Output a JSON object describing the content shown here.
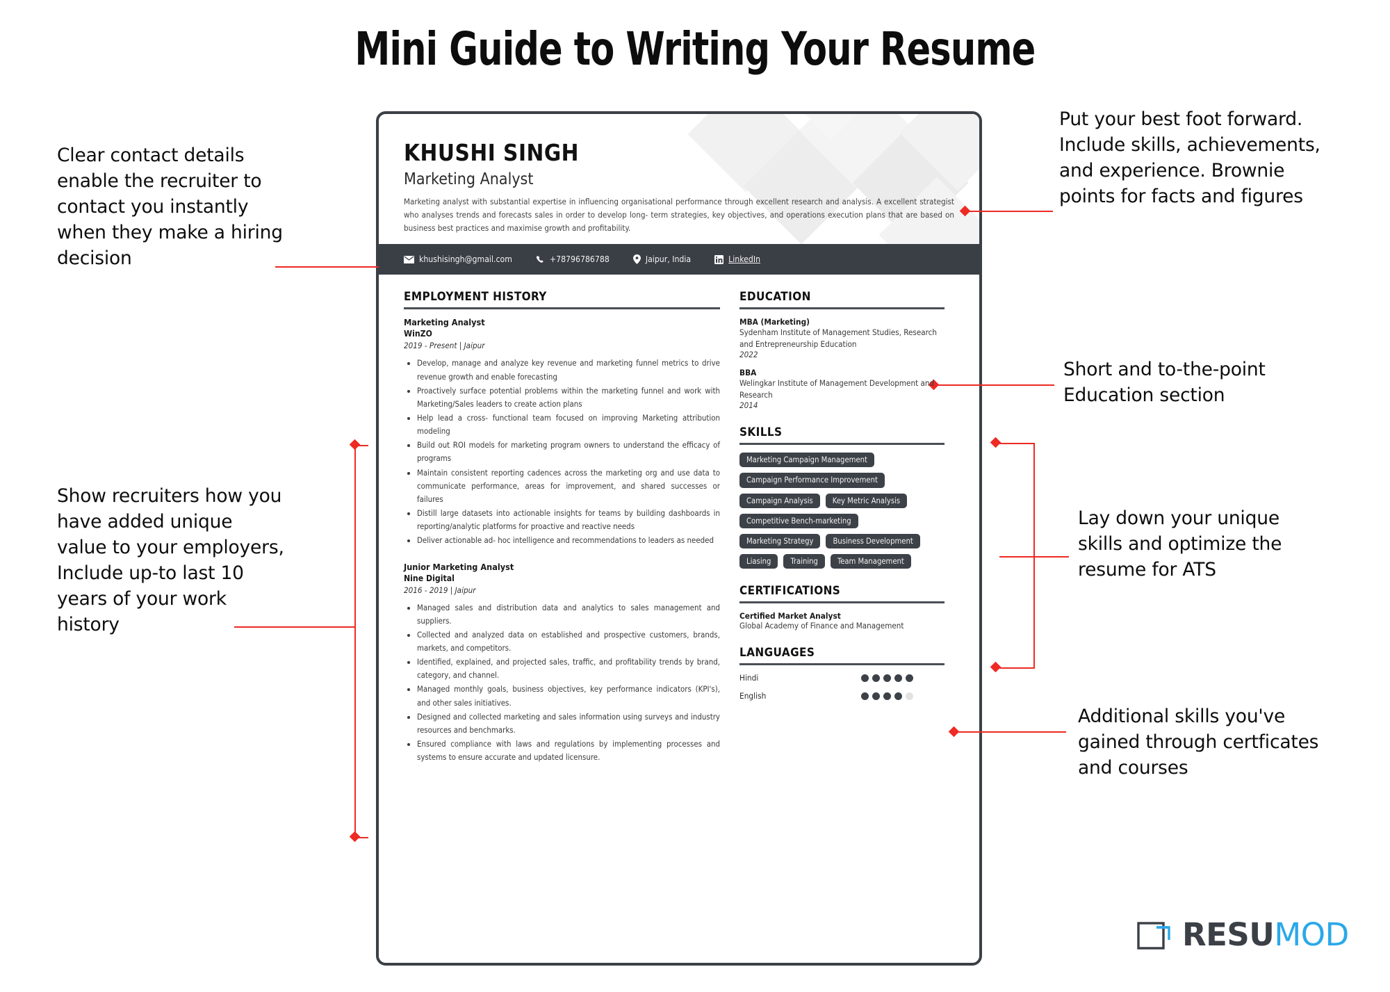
{
  "page": {
    "title": "Mini Guide to Writing Your Resume"
  },
  "resume": {
    "name": "KHUSHI SINGH",
    "role": "Marketing Analyst",
    "summary": "Marketing analyst with substantial expertise in influencing organisational performance through excellent research and analysis. A excellent strategist who analyses trends and forecasts sales in order to develop long- term strategies, key objectives, and operations execution plans that are based on business best practices and maximise growth and profitability.",
    "contact": {
      "email": "khushisingh@gmail.com",
      "phone": "+78796786788",
      "location": "Jaipur, India",
      "linkedin": "LinkedIn"
    },
    "sections": {
      "employment_title": "EMPLOYMENT HISTORY",
      "education_title": "EDUCATION",
      "skills_title": "SKILLS",
      "certifications_title": "CERTIFICATIONS",
      "languages_title": "LANGUAGES"
    },
    "jobs": [
      {
        "title": "Marketing Analyst",
        "company": "WinZO",
        "meta": "2019 - Present | Jaipur",
        "bullets": [
          "Develop, manage and analyze key revenue and marketing funnel metrics to drive revenue growth and enable forecasting",
          "Proactively surface potential problems within the marketing funnel and work with Marketing/Sales leaders to create action plans",
          "Help lead a cross- functional team focused on improving Marketing attribution modeling",
          "Build out ROI models for marketing program owners to understand the efficacy of programs",
          "Maintain consistent reporting cadences across the marketing org and use data to communicate performance, areas for improvement, and shared successes or failures",
          "Distill large datasets into actionable insights for teams by building dashboards in reporting/analytic platforms for proactive and reactive needs",
          "Deliver actionable ad- hoc intelligence and recommendations to leaders as needed"
        ]
      },
      {
        "title": "Junior Marketing Analyst",
        "company": "Nine Digital",
        "meta": "2016 - 2019 | Jaipur",
        "bullets": [
          "Managed sales and distribution data and analytics to sales management and suppliers.",
          "Collected and analyzed data on established and prospective customers, brands, markets, and competitors.",
          "Identified, explained, and projected sales, traffic, and profitability trends by brand, category, and channel.",
          "Managed monthly goals, business objectives, key performance indicators (KPI's), and other sales initiatives.",
          "Designed and collected marketing and sales information using surveys and industry resources and benchmarks.",
          "Ensured compliance with laws and regulations by implementing processes and systems to ensure accurate and updated licensure."
        ]
      }
    ],
    "education": [
      {
        "degree": "MBA (Marketing)",
        "school": "Sydenham Institute of Management Studies, Research and Entrepreneurship Education",
        "year": "2022"
      },
      {
        "degree": "BBA",
        "school": "Welingkar Institute of Management Development and Research",
        "year": "2014"
      }
    ],
    "skills": [
      "Marketing Campaign Management",
      "Campaign Performance Improvement",
      "Campaign Analysis",
      "Key Metric Analysis",
      "Competitive Bench-marketing",
      "Marketing Strategy",
      "Business Development",
      "Liasing",
      "Training",
      "Team Management"
    ],
    "certifications": [
      {
        "name": "Certified Market Analyst",
        "org": "Global Academy of Finance and Management"
      }
    ],
    "languages": [
      {
        "name": "Hindi",
        "level": 5,
        "max": 5
      },
      {
        "name": "English",
        "level": 4,
        "max": 5
      }
    ]
  },
  "annotations": {
    "contact": "Clear contact details enable the recruiter to contact you instantly when they make a hiring decision",
    "experience": "Show recruiters how you have added unique value to your employers, Include up-to last 10 years of your work history",
    "summary": "Put your best foot forward. Include skills, achievements, and experience. Brownie points for facts and figures",
    "education": "Short and to-the-point Education section",
    "skills": "Lay down your unique skills and optimize the resume for ATS",
    "certifications": "Additional skills you've gained through certficates and courses"
  },
  "brand": {
    "name_dark": "RESU",
    "name_light": "MOD",
    "accent": "#2aa8e8",
    "dark": "#3b3f46"
  },
  "colors": {
    "connector_red": "#ee2a24",
    "card_border": "#3b3f46",
    "bar_dark": "#3a3e45",
    "tag_dark": "#3d4148"
  }
}
